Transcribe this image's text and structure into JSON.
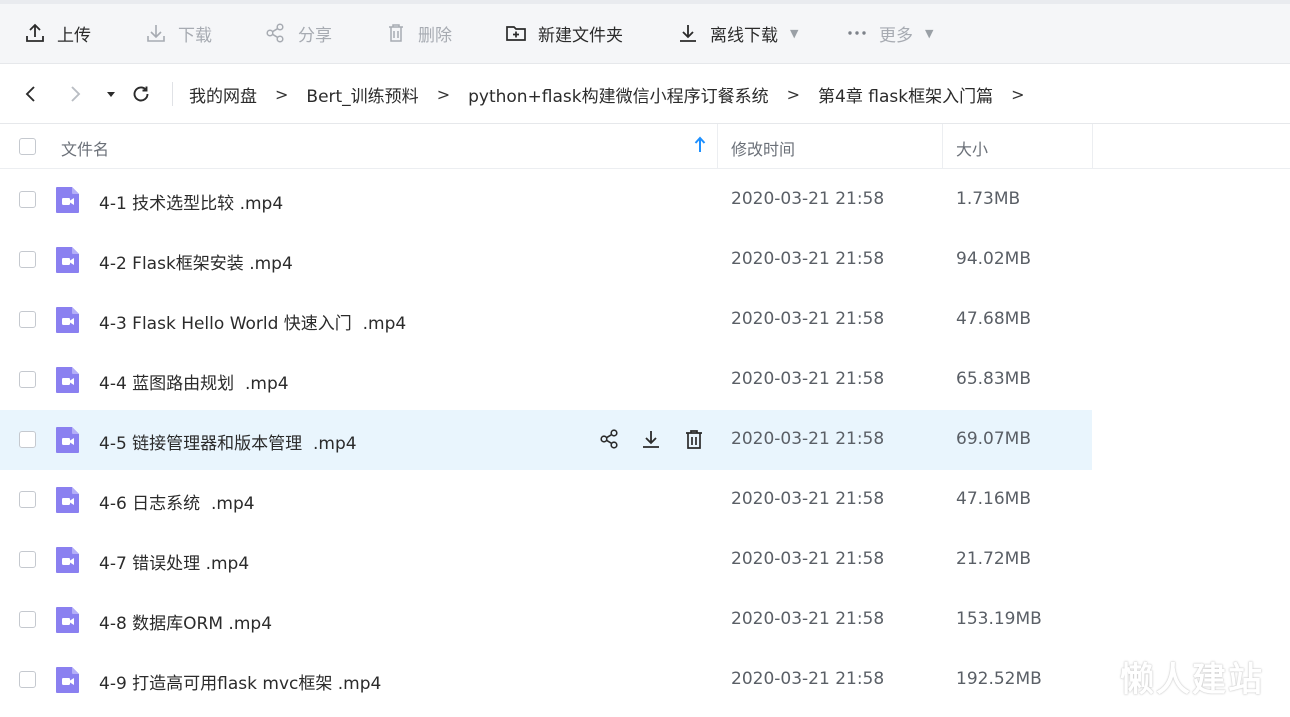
{
  "toolbar": {
    "upload": "上传",
    "download": "下载",
    "share": "分享",
    "delete": "删除",
    "new_folder": "新建文件夹",
    "offline_download": "离线下载",
    "more": "更多"
  },
  "breadcrumb": [
    "我的网盘",
    "Bert_训练预料",
    "python+flask构建微信小程序订餐系统",
    "第4章 flask框架入门篇"
  ],
  "breadcrumb_separator": ">",
  "columns": {
    "name": "文件名",
    "modified": "修改时间",
    "size": "大小"
  },
  "files": [
    {
      "name": "4-1 技术选型比较 .mp4",
      "modified": "2020-03-21 21:58",
      "size": "1.73MB"
    },
    {
      "name": "4-2 Flask框架安装 .mp4",
      "modified": "2020-03-21 21:58",
      "size": "94.02MB"
    },
    {
      "name": "4-3 Flask Hello World 快速入门  .mp4",
      "modified": "2020-03-21 21:58",
      "size": "47.68MB"
    },
    {
      "name": "4-4 蓝图路由规划  .mp4",
      "modified": "2020-03-21 21:58",
      "size": "65.83MB"
    },
    {
      "name": "4-5 链接管理器和版本管理  .mp4",
      "modified": "2020-03-21 21:58",
      "size": "69.07MB"
    },
    {
      "name": "4-6 日志系统  .mp4",
      "modified": "2020-03-21 21:58",
      "size": "47.16MB"
    },
    {
      "name": "4-7 错误处理 .mp4",
      "modified": "2020-03-21 21:58",
      "size": "21.72MB"
    },
    {
      "name": "4-8 数据库ORM .mp4",
      "modified": "2020-03-21 21:58",
      "size": "153.19MB"
    },
    {
      "name": "4-9 打造高可用flask mvc框架 .mp4",
      "modified": "2020-03-21 21:58",
      "size": "192.52MB"
    }
  ],
  "watermark": "懒人建站",
  "colors": {
    "video_icon": "#8a80f0",
    "hover_row": "#e9f5fd",
    "sort_arrow": "#1e90ff"
  }
}
